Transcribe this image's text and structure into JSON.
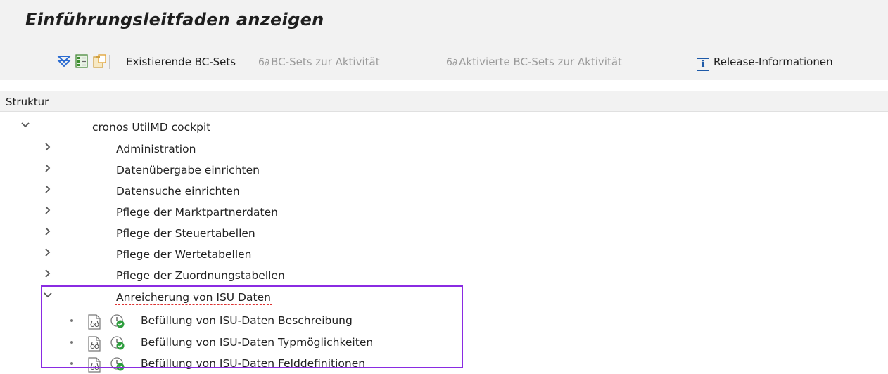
{
  "title": "Einführungsleitfaden anzeigen",
  "toolbar": {
    "icons": [
      "filter-expand-icon",
      "document-tree-icon",
      "clipboard-icon"
    ],
    "existing_bc_sets": "Existierende BC-Sets",
    "bc_sets_activity": "BC-Sets zur Aktivität",
    "activated_bc_sets": "Aktivierte BC-Sets zur Aktivität",
    "release_info": "Release-Informationen",
    "info_glyph": "i",
    "glasses_glyph": "6∂"
  },
  "tree": {
    "header": "Struktur",
    "root": "cronos UtilMD cockpit",
    "items": [
      "Administration",
      "Datenübergabe einrichten",
      "Datensuche einrichten",
      "Pflege der Marktpartnerdaten",
      "Pflege der Steuertabellen",
      "Pflege der Wertetabellen",
      "Pflege der Zuordnungstabellen"
    ],
    "expanded_node": "Anreicherung von ISU Daten",
    "activities": [
      "Befüllung von ISU-Daten Beschreibung",
      "Befüllung von ISU-Daten Typmöglichkeiten",
      "Befüllung von ISU-Daten Felddefinitionen"
    ]
  },
  "colors": {
    "accent_blue": "#1e5aa8",
    "highlight_purple": "#8a2be2",
    "check_green": "#2e9e3e"
  }
}
